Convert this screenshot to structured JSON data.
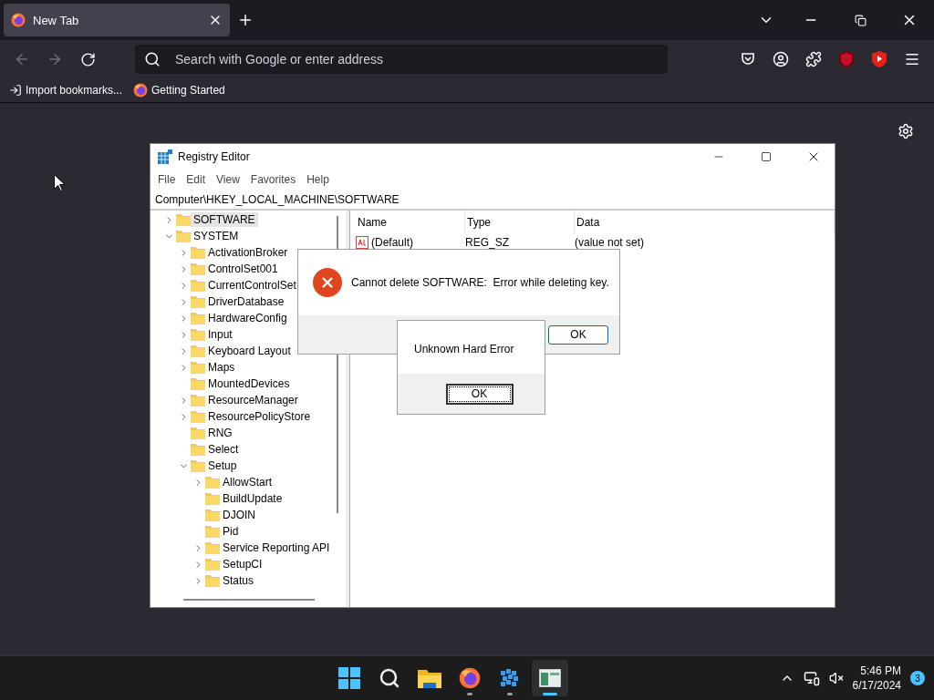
{
  "browser": {
    "tabs": [
      {
        "title": "New Tab",
        "selected": true
      }
    ],
    "address": {
      "placeholder": "Search with Google or enter address"
    },
    "bookmarks": [
      {
        "label": "Import bookmarks...",
        "kind": "import"
      },
      {
        "label": "Getting Started",
        "kind": "firefox"
      }
    ]
  },
  "regedit": {
    "title": "Registry Editor",
    "menu": [
      "File",
      "Edit",
      "View",
      "Favorites",
      "Help"
    ],
    "address": "Computer\\HKEY_LOCAL_MACHINE\\SOFTWARE",
    "tree": [
      {
        "label": "SOFTWARE",
        "kind": "branch",
        "expanded": false,
        "selected": true
      },
      {
        "label": "SYSTEM",
        "kind": "branch",
        "expanded": true,
        "selected": false,
        "children": [
          {
            "label": "ActivationBroker",
            "kind": "branch",
            "expanded": false,
            "selected": false
          },
          {
            "label": "ControlSet001",
            "kind": "branch",
            "expanded": false,
            "selected": false
          },
          {
            "label": "CurrentControlSet",
            "kind": "branch",
            "expanded": false,
            "selected": false
          },
          {
            "label": "DriverDatabase",
            "kind": "branch",
            "expanded": false,
            "selected": false
          },
          {
            "label": "HardwareConfig",
            "kind": "branch",
            "expanded": false,
            "selected": false
          },
          {
            "label": "Input",
            "kind": "branch",
            "expanded": false,
            "selected": false
          },
          {
            "label": "Keyboard Layout",
            "kind": "branch",
            "expanded": false,
            "selected": false
          },
          {
            "label": "Maps",
            "kind": "branch",
            "expanded": false,
            "selected": false
          },
          {
            "label": "MountedDevices",
            "kind": "leaf",
            "selected": false
          },
          {
            "label": "ResourceManager",
            "kind": "branch",
            "expanded": false,
            "selected": false
          },
          {
            "label": "ResourcePolicyStore",
            "kind": "branch",
            "expanded": false,
            "selected": false
          },
          {
            "label": "RNG",
            "kind": "leaf",
            "selected": false
          },
          {
            "label": "Select",
            "kind": "leaf",
            "selected": false
          },
          {
            "label": "Setup",
            "kind": "branch",
            "expanded": true,
            "selected": false,
            "children": [
              {
                "label": "AllowStart",
                "kind": "branch",
                "expanded": false,
                "selected": false
              },
              {
                "label": "BuildUpdate",
                "kind": "leaf",
                "selected": false
              },
              {
                "label": "DJOIN",
                "kind": "leaf",
                "selected": false
              },
              {
                "label": "Pid",
                "kind": "leaf",
                "selected": false
              },
              {
                "label": "Service Reporting API",
                "kind": "branch",
                "expanded": false,
                "selected": false
              },
              {
                "label": "SetupCI",
                "kind": "branch",
                "expanded": false,
                "selected": false
              },
              {
                "label": "Status",
                "kind": "branch",
                "expanded": false,
                "selected": false
              }
            ]
          }
        ]
      }
    ],
    "columns": [
      "Name",
      "Type",
      "Data"
    ],
    "values": [
      {
        "name": "(Default)",
        "type": "REG_SZ",
        "data": "(value not set)"
      }
    ]
  },
  "error_dialog": {
    "message": "Cannot delete SOFTWARE:  Error while deleting key.",
    "button": "OK"
  },
  "hard_error_dialog": {
    "message": "Unknown Hard Error",
    "button": "OK"
  },
  "taskbar": {
    "apps": [
      {
        "kind": "start",
        "running": false,
        "selected": false
      },
      {
        "kind": "search",
        "running": false,
        "selected": false
      },
      {
        "kind": "explorer",
        "running": false,
        "selected": false
      },
      {
        "kind": "firefox",
        "running": true,
        "selected": false
      },
      {
        "kind": "cubes",
        "running": true,
        "selected": false
      },
      {
        "kind": "regedit",
        "running": true,
        "selected": true
      }
    ],
    "time": "5:46 PM",
    "date": "6/17/2024",
    "notifications": "3"
  }
}
